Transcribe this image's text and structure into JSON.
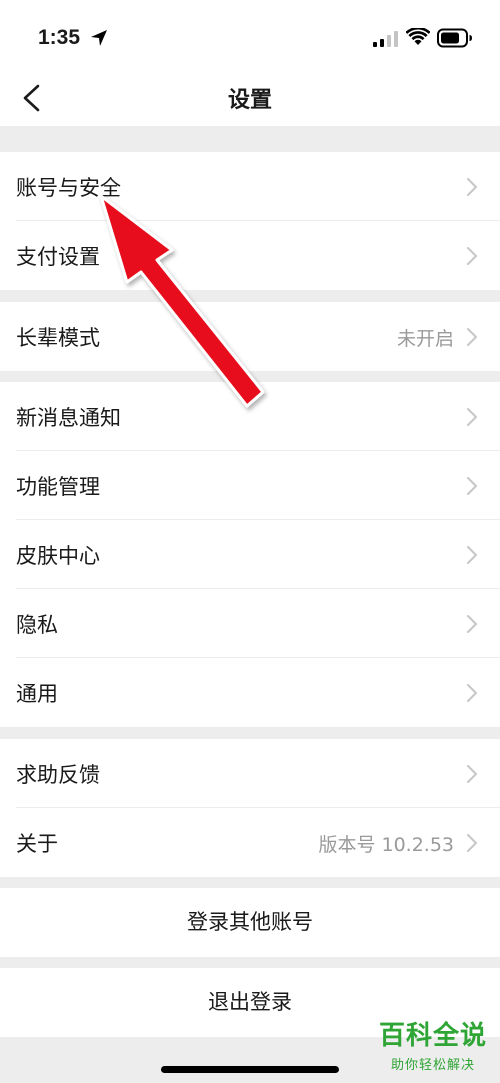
{
  "status_bar": {
    "time": "1:35"
  },
  "nav": {
    "title": "设置"
  },
  "groups": [
    {
      "items": [
        {
          "label": "账号与安全",
          "value": ""
        },
        {
          "label": "支付设置",
          "value": ""
        }
      ]
    },
    {
      "items": [
        {
          "label": "长辈模式",
          "value": "未开启"
        }
      ]
    },
    {
      "items": [
        {
          "label": "新消息通知",
          "value": ""
        },
        {
          "label": "功能管理",
          "value": ""
        },
        {
          "label": "皮肤中心",
          "value": ""
        },
        {
          "label": "隐私",
          "value": ""
        },
        {
          "label": "通用",
          "value": ""
        }
      ]
    },
    {
      "items": [
        {
          "label": "求助反馈",
          "value": ""
        },
        {
          "label": "关于",
          "value": "版本号 10.2.53"
        }
      ]
    }
  ],
  "actions": {
    "switch_account": "登录其他账号",
    "logout": "退出登录"
  },
  "watermark": {
    "title": "百科全说",
    "subtitle": "助你轻松解决"
  },
  "colors": {
    "annotation_arrow": "#e8101e",
    "watermark": "#2fa535",
    "secondary_text": "#9a9a9a"
  }
}
